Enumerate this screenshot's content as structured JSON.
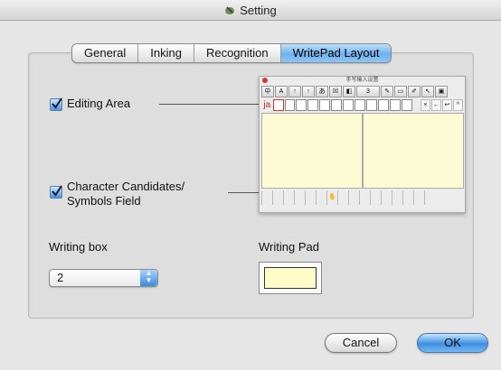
{
  "window": {
    "title": "Setting",
    "icon": "setting-app-icon"
  },
  "tabs": [
    {
      "label": "General",
      "active": false
    },
    {
      "label": "Inking",
      "active": false
    },
    {
      "label": "Recognition",
      "active": false
    },
    {
      "label": "WritePad Layout",
      "active": true
    }
  ],
  "layout": {
    "editing_area": {
      "label": "Editing Area",
      "checked": true
    },
    "candidates": {
      "label_line1": "Character Candidates/",
      "label_line2": "Symbols Field",
      "checked": true
    },
    "writing_box": {
      "label": "Writing box",
      "value": "2"
    },
    "writing_pad": {
      "label": "Writing Pad",
      "color": "#fffcc8"
    },
    "preview": {
      "title": "手写输入设置",
      "toolbar": [
        "中",
        "A",
        "↑",
        "↑",
        "あ",
        "☒",
        "◧",
        "3",
        "",
        "✎",
        "▭",
        "✐",
        "↖",
        "▣"
      ],
      "row_marker": "ja",
      "row_controls": [
        "×",
        "←",
        "↩",
        "^"
      ],
      "area_color": "#fdfbd6"
    }
  },
  "buttons": {
    "cancel": "Cancel",
    "ok": "OK"
  },
  "colors": {
    "accent": "#4a96e4",
    "panel": "#dedede"
  }
}
